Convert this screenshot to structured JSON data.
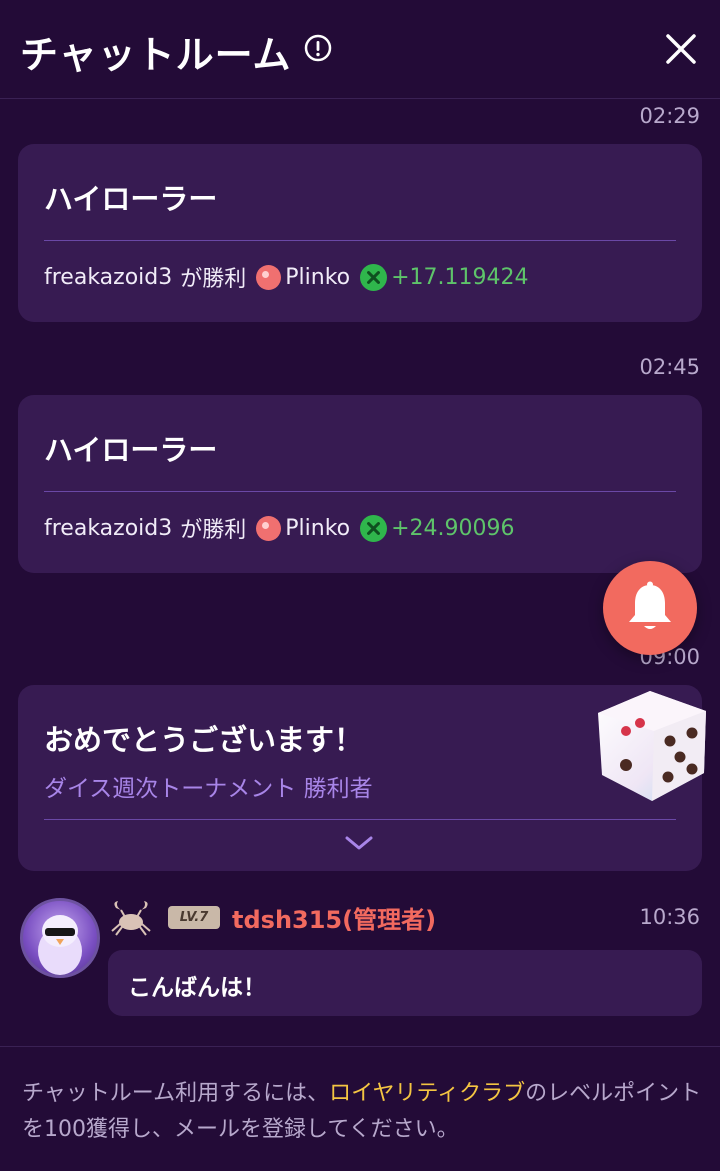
{
  "header": {
    "title": "チャットルーム"
  },
  "messages": [
    {
      "time": "02:29",
      "title": "ハイローラー",
      "player": "freakazoid3",
      "action": "が勝利",
      "game": "Plinko",
      "amount": "+17.119424"
    },
    {
      "time": "02:45",
      "title": "ハイローラー",
      "player": "freakazoid3",
      "action": "が勝利",
      "game": "Plinko",
      "amount": "+24.90096"
    }
  ],
  "tournament": {
    "time": "09:00",
    "title": "おめでとうございます！",
    "subtitle": "ダイス週次トーナメント 勝利者"
  },
  "user_message": {
    "level": "LV.7",
    "username": "tdsh315(管理者)",
    "time": "10:36",
    "text": "こんばんは！"
  },
  "footer": {
    "text_before": "チャットルーム利用するには、",
    "link": "ロイヤリティクラブ",
    "text_after": "のレベルポイントを100獲得し、メールを登録してください。"
  },
  "colors": {
    "background": "#230b37",
    "card": "#371b52",
    "accent_red": "#f26a5f",
    "win_green": "#5ec46a",
    "link_yellow": "#f4c542",
    "subtitle_purple": "#a885e8"
  },
  "icons": [
    "info-icon",
    "close-icon",
    "plinko-icon",
    "coin-icon",
    "bell-icon",
    "dice-icon",
    "chevron-down-icon",
    "crab-icon",
    "avatar"
  ]
}
